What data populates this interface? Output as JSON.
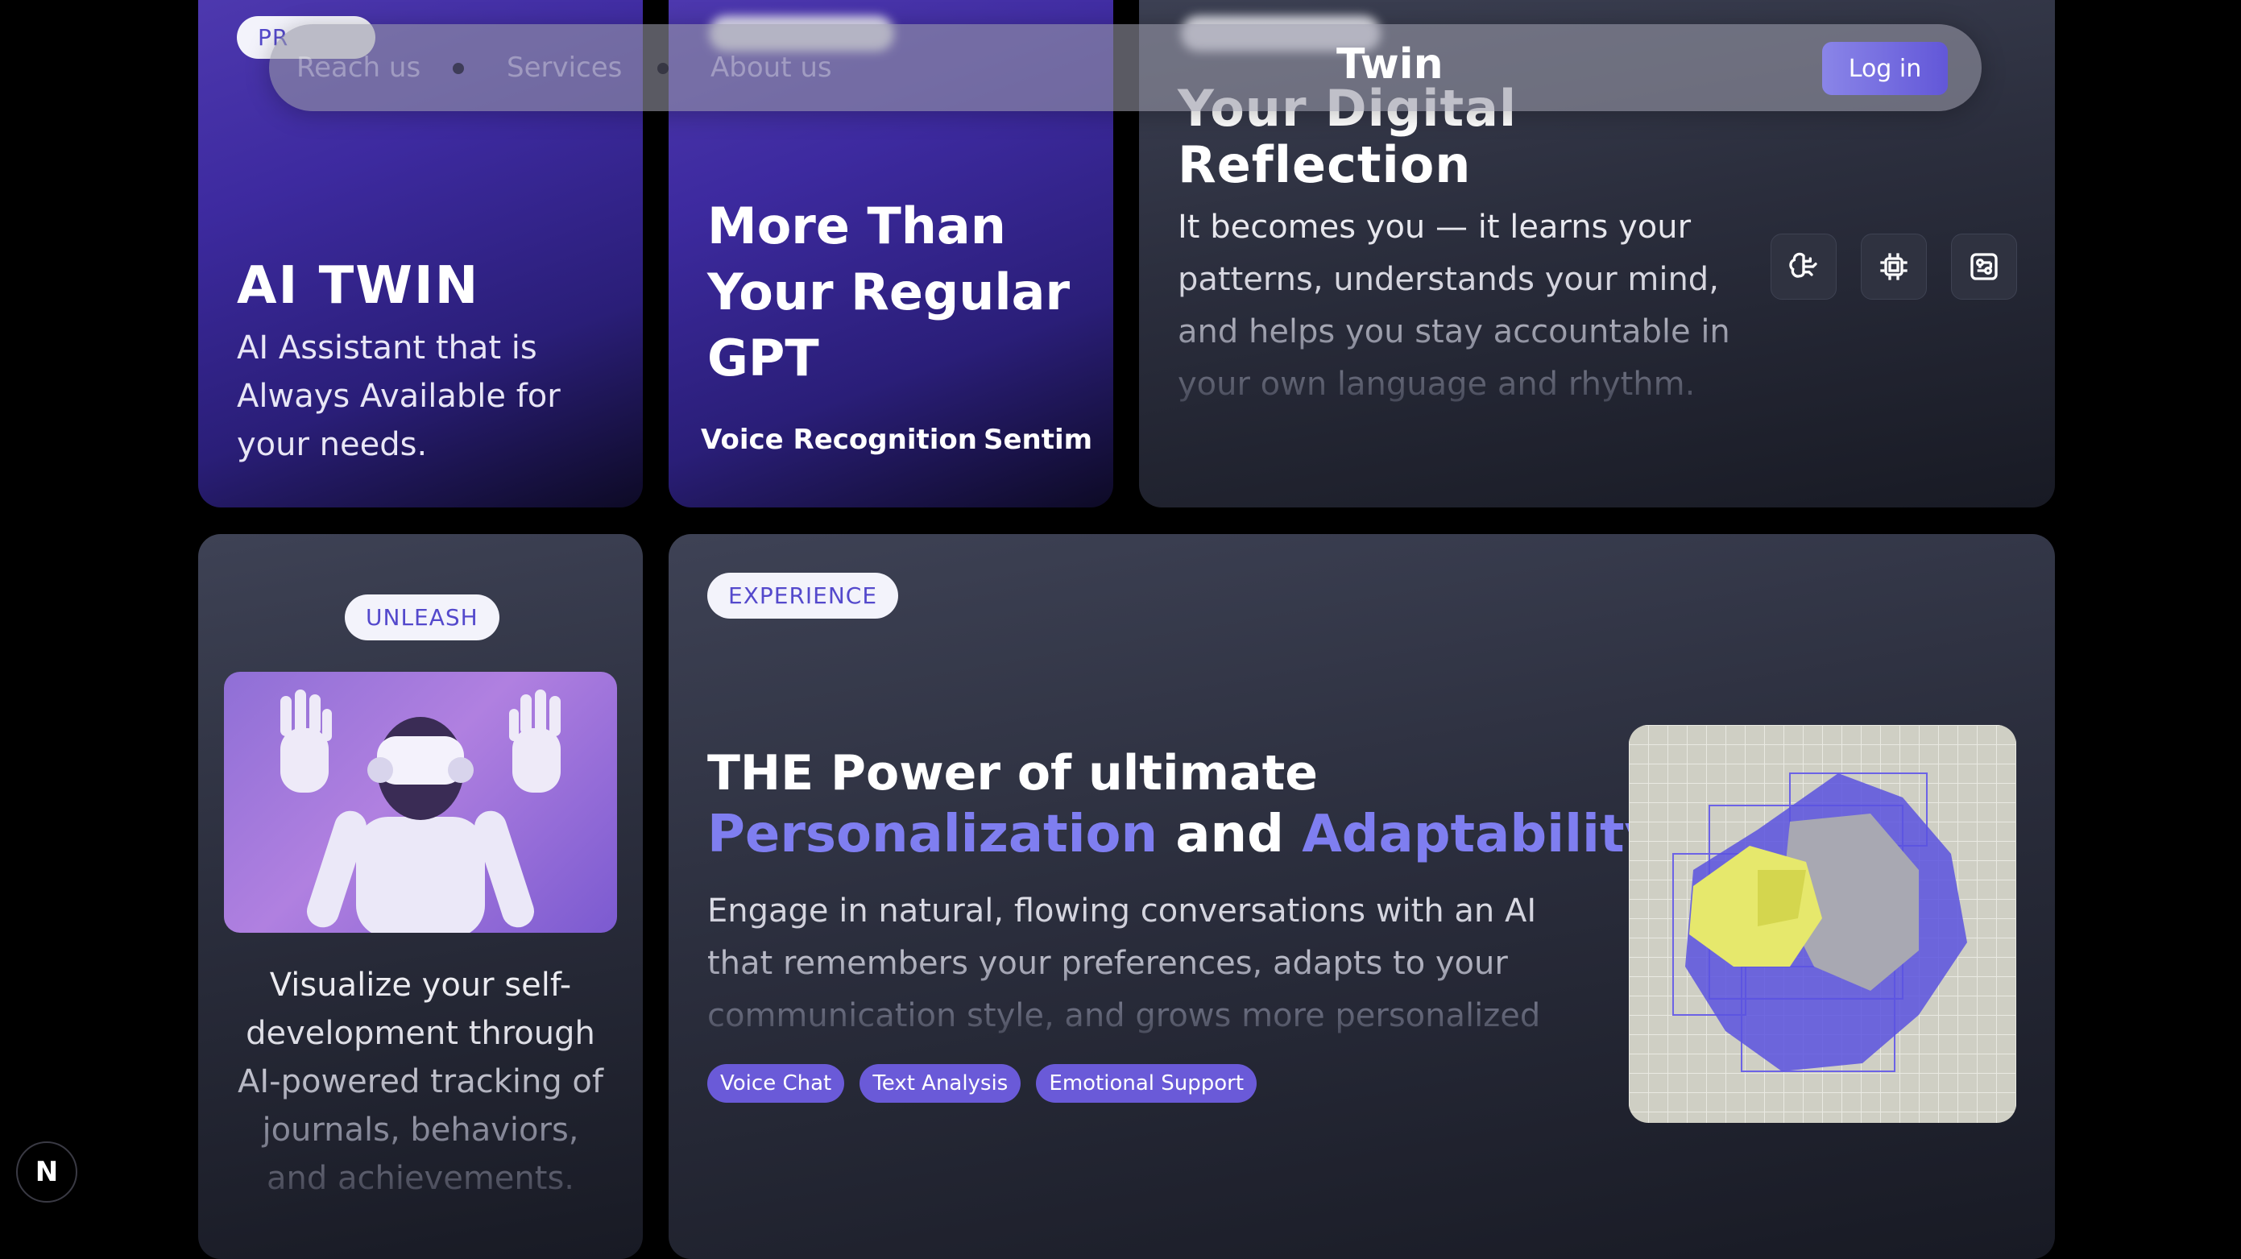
{
  "nav": {
    "links": [
      "Reach us",
      "Services",
      "About us"
    ],
    "brand": "Twin",
    "login_label": "Log in"
  },
  "card_ai_twin": {
    "badge": "PR",
    "title": "AI TWIN",
    "text": "AI Assistant that is Always Available for your needs."
  },
  "card_gpt": {
    "title": "More Than Your Regular GPT",
    "marquee": [
      "Voice Recognition",
      "Sentim"
    ]
  },
  "card_reflection": {
    "title_line1": "Your Digital",
    "title_line2": "Reflection",
    "text": "It becomes you — it learns your patterns, understands your mind, and helps you stay accountable in your own language and rhythm.",
    "icons": [
      "brain-icon",
      "cpu-chip-icon",
      "circuit-board-icon"
    ]
  },
  "card_unleash": {
    "badge": "UNLEASH",
    "text": "Visualize your self-development through AI-powered tracking of journals, behaviors, and achievements."
  },
  "card_experience": {
    "badge": "EXPERIENCE",
    "heading_line1": "THE Power of ultimate",
    "heading_word1": "Personalization",
    "heading_and": "and",
    "heading_word2": "Adaptability",
    "text": "Engage in natural, flowing conversations with an AI that remembers your preferences, adapts to your communication style, and grows more personalized with every interaction.",
    "tags": [
      "Voice Chat",
      "Text Analysis",
      "Emotional Support"
    ]
  },
  "dev_badge": "N",
  "colors": {
    "accent": "#7f7ef0",
    "tag_bg": "#6a5ad8",
    "badge_text": "#5449cc"
  }
}
